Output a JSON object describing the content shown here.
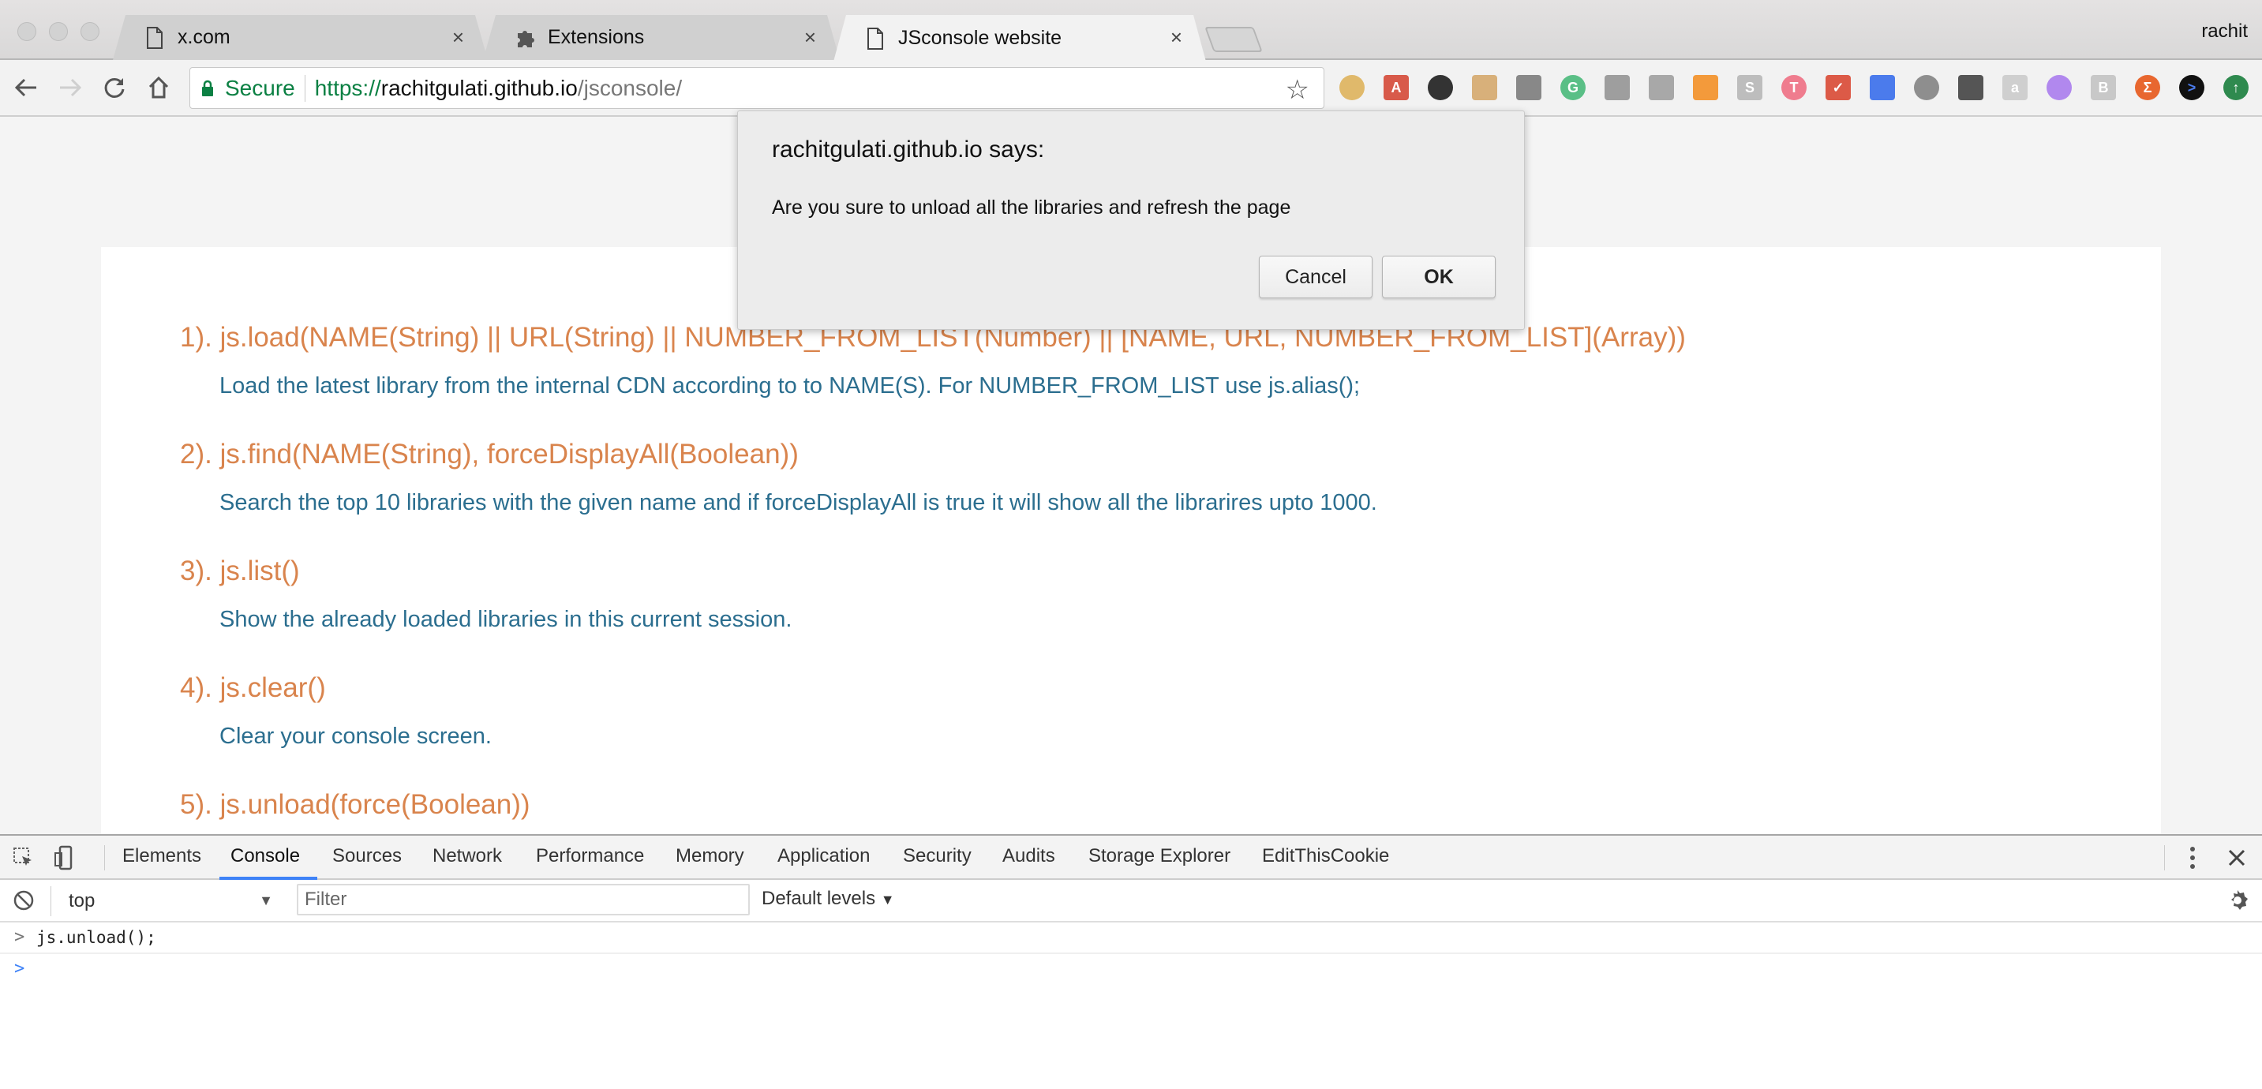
{
  "browser": {
    "tabs": [
      {
        "title": "x.com",
        "icon": "page-icon",
        "active": false
      },
      {
        "title": "Extensions",
        "icon": "puzzle-icon",
        "active": false
      },
      {
        "title": "JSconsole website",
        "icon": "page-icon",
        "active": true
      }
    ],
    "profile_name": "rachit",
    "omnibox": {
      "security_label": "Secure",
      "url_scheme": "https://",
      "url_host": "rachitgulati.github.io",
      "url_path": "/jsconsole/"
    },
    "extensions": [
      {
        "name": "editthiscookie-icon",
        "color": "#e0b96b"
      },
      {
        "name": "book-icon",
        "color": "#d85a4a"
      },
      {
        "name": "camera-lens-icon",
        "color": "#333333"
      },
      {
        "name": "ruler-icon",
        "color": "#d8b07a"
      },
      {
        "name": "gear-bug-icon",
        "color": "#888888"
      },
      {
        "name": "grammarly-icon",
        "color": "#5abf86"
      },
      {
        "name": "outlet-icon",
        "color": "#9e9e9e"
      },
      {
        "name": "react-icon",
        "color": "#a8a8a8"
      },
      {
        "name": "tag-icon",
        "color": "#f39a3b"
      },
      {
        "name": "s-icon",
        "color": "#bdbdbd"
      },
      {
        "name": "t-icon",
        "color": "#ef7c8e"
      },
      {
        "name": "todoist-icon",
        "color": "#dc5a47"
      },
      {
        "name": "lighthouse-icon",
        "color": "#4b7bec"
      },
      {
        "name": "clock-icon",
        "color": "#8e8e8e"
      },
      {
        "name": "eyedropper-icon",
        "color": "#555555"
      },
      {
        "name": "chat-icon",
        "color": "#cfcfcf"
      },
      {
        "name": "pen-icon",
        "color": "#b188ee"
      },
      {
        "name": "b-icon",
        "color": "#c8c8c8"
      },
      {
        "name": "sigma-icon",
        "color": "#e8672f"
      },
      {
        "name": "prompt-icon",
        "color": "#111111"
      },
      {
        "name": "upload-icon",
        "color": "#2f8a4f"
      }
    ]
  },
  "page": {
    "commands": [
      {
        "signature": "1). js.load(NAME(String) || URL(String) || NUMBER_FROM_LIST(Number) || [NAME, URL, NUMBER_FROM_LIST](Array))",
        "description": "Load the latest library from the internal CDN according to to NAME(S). For NUMBER_FROM_LIST use js.alias();"
      },
      {
        "signature": "2). js.find(NAME(String), forceDisplayAll(Boolean))",
        "description": "Search the top 10 libraries with the given name and if forceDisplayAll is true it will show all the librarires upto 1000."
      },
      {
        "signature": "3). js.list()",
        "description": "Show the already loaded libraries in this current session."
      },
      {
        "signature": "4). js.clear()",
        "description": "Clear your console screen."
      },
      {
        "signature": "5). js.unload(force(Boolean))",
        "description": ""
      }
    ],
    "colors": {
      "command": "#d9844d",
      "description": "#2b6e8f"
    }
  },
  "dialog": {
    "title": "rachitgulati.github.io says:",
    "message": "Are you sure to unload all the libraries and refresh the page",
    "cancel_label": "Cancel",
    "ok_label": "OK"
  },
  "devtools": {
    "tabs": [
      "Elements",
      "Console",
      "Sources",
      "Network",
      "Performance",
      "Memory",
      "Application",
      "Security",
      "Audits",
      "Storage Explorer",
      "EditThisCookie"
    ],
    "active_tab": "Console",
    "context": "top",
    "filter_placeholder": "Filter",
    "levels_label": "Default levels",
    "console_lines": [
      {
        "prompt": ">",
        "code": "js.unload();"
      }
    ],
    "input_prompt": ">",
    "accent": "#3e82f7"
  }
}
